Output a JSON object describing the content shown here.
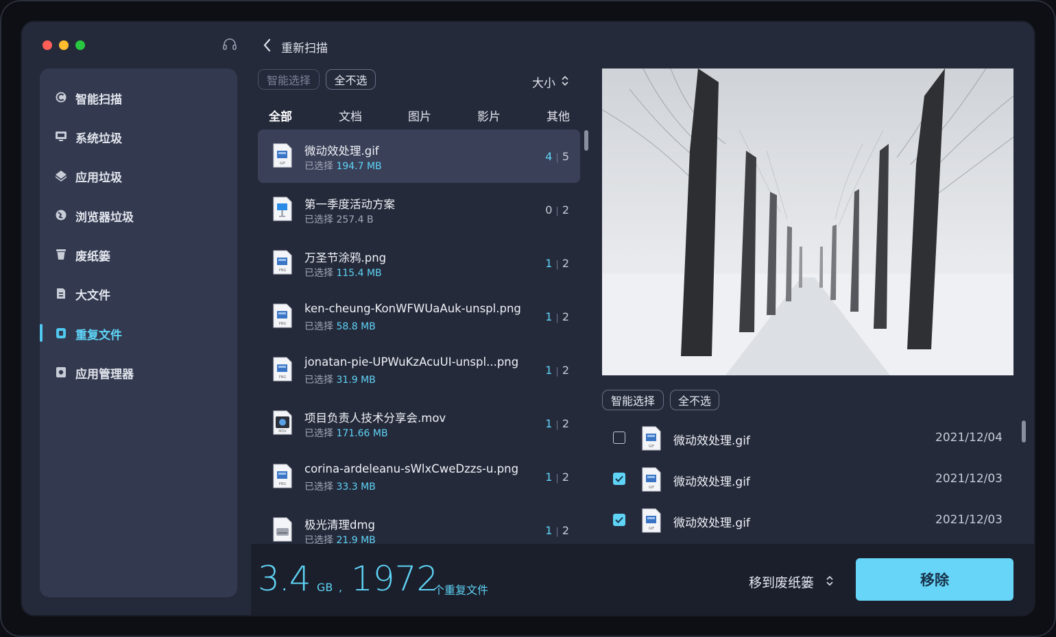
{
  "sidebar": {
    "items": [
      {
        "label": "智能扫描",
        "icon": "smart-scan-icon"
      },
      {
        "label": "系统垃圾",
        "icon": "system-junk-icon"
      },
      {
        "label": "应用垃圾",
        "icon": "app-junk-icon"
      },
      {
        "label": "浏览器垃圾",
        "icon": "browser-junk-icon"
      },
      {
        "label": "废纸篓",
        "icon": "trash-icon"
      },
      {
        "label": "大文件",
        "icon": "large-file-icon"
      },
      {
        "label": "重复文件",
        "icon": "duplicate-file-icon",
        "active": true
      },
      {
        "label": "应用管理器",
        "icon": "app-manager-icon"
      }
    ]
  },
  "header": {
    "rescan_label": "重新扫描"
  },
  "list_toolbar": {
    "smart_select": "智能选择",
    "deselect_all": "全不选",
    "sort_label": "大小"
  },
  "tabs": [
    "全部",
    "文档",
    "图片",
    "影片",
    "其他"
  ],
  "selected_prefix": "已选择",
  "files": [
    {
      "name": "微动效处理.gif",
      "size": "194.7 MB",
      "selected": "4",
      "total": "5",
      "type": "GIF"
    },
    {
      "name": "第一季度活动方案",
      "size": "257.4 B",
      "selected": "0",
      "total": "2",
      "type": "KEY"
    },
    {
      "name": "万圣节涂鸦.png",
      "size": "115.4 MB",
      "selected": "1",
      "total": "2",
      "type": "PNG"
    },
    {
      "name": "ken-cheung-KonWFWUaAuk-unspl.png",
      "size": "58.8 MB",
      "selected": "1",
      "total": "2",
      "type": "PNG"
    },
    {
      "name": "jonatan-pie-UPWuKzAcuUI-unspl...png",
      "size": "31.9 MB",
      "selected": "1",
      "total": "2",
      "type": "PNG"
    },
    {
      "name": "项目负责人技术分享会.mov",
      "size": "171.66 MB",
      "selected": "1",
      "total": "2",
      "type": "MOV"
    },
    {
      "name": "corina-ardeleanu-sWlxCweDzzs-u.png",
      "size": "33.3 MB",
      "selected": "1",
      "total": "2",
      "type": "PNG"
    },
    {
      "name": "极光清理dmg",
      "size": "21.9 MB",
      "selected": "1",
      "total": "2",
      "type": "DMG"
    }
  ],
  "preview_toolbar": {
    "smart_select": "智能选择",
    "deselect_all": "全不选"
  },
  "duplicates": [
    {
      "name": "微动效处理.gif",
      "date": "2021/12/04",
      "checked": false
    },
    {
      "name": "微动效处理.gif",
      "date": "2021/12/03",
      "checked": true
    },
    {
      "name": "微动效处理.gif",
      "date": "2021/12/03",
      "checked": true
    }
  ],
  "summary": {
    "size": "3.4",
    "size_unit": "GB",
    "comma": ",",
    "count": "1972",
    "count_label": "个重复文件"
  },
  "actions": {
    "move_label": "移到废纸篓",
    "remove_label": "移除"
  },
  "colors": {
    "accent": "#5fd4f6",
    "button": "#66d5f7",
    "window": "#252a3b",
    "sidebar": "#33394f"
  }
}
